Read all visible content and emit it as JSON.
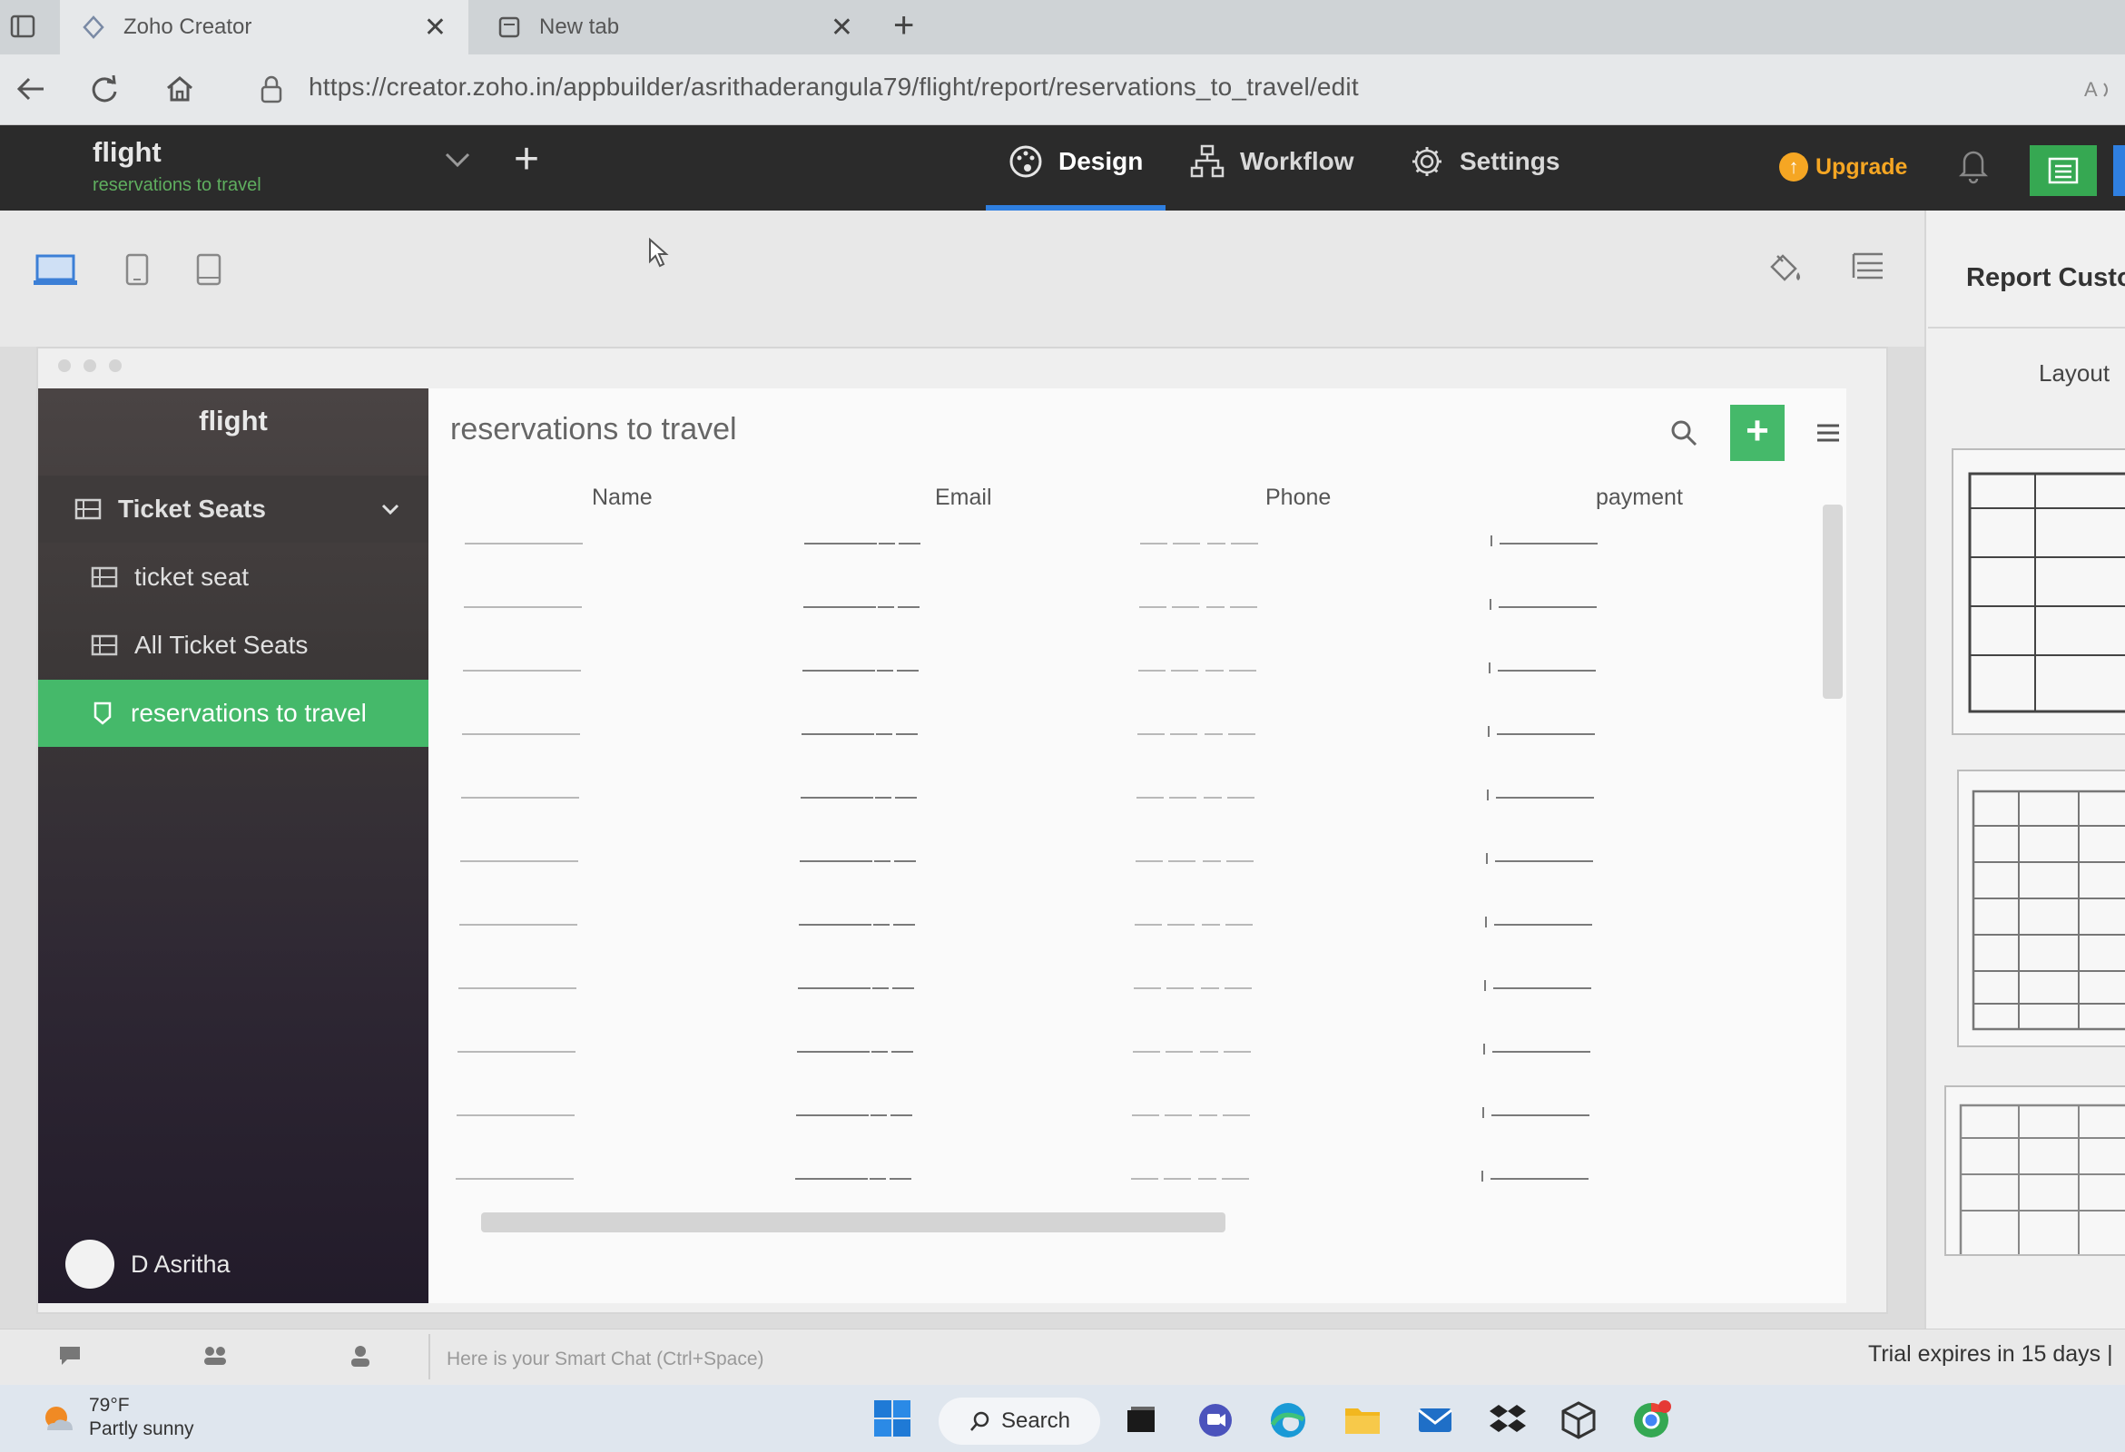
{
  "browser": {
    "tabs": [
      {
        "title": "Zoho Creator"
      },
      {
        "title": "New tab"
      }
    ],
    "close_glyph": "✕",
    "new_tab_glyph": "+",
    "url": "https://creator.zoho.in/appbuilder/asrithaderangula79/flight/report/reservations_to_travel/edit"
  },
  "app": {
    "name": "flight",
    "subtitle": "reservations to travel",
    "add_glyph": "+",
    "nav": {
      "design": "Design",
      "workflow": "Workflow",
      "settings": "Settings"
    },
    "upgrade": "Upgrade",
    "upgrade_glyph": "↑"
  },
  "sidebar": {
    "brand": "flight",
    "items": [
      {
        "label": "Ticket Seats",
        "level": 1,
        "icon": "table-icon"
      },
      {
        "label": "ticket seat",
        "level": 2,
        "icon": "table-icon"
      },
      {
        "label": "All Ticket Seats",
        "level": 2,
        "icon": "table-icon"
      },
      {
        "label": "reservations to travel",
        "level": 2,
        "icon": "report-icon",
        "active": true
      }
    ],
    "user": "D Asritha"
  },
  "report": {
    "title": "reservations to travel",
    "add_glyph": "+",
    "columns": [
      "Name",
      "Email",
      "Phone",
      "payment"
    ],
    "placeholder_rows": 11
  },
  "right_panel": {
    "title": "Report Customiz",
    "layout_label": "Layout"
  },
  "bottom": {
    "chat_placeholder": "Here is your Smart Chat (Ctrl+Space)",
    "trial": "Trial expires in 15 days",
    "trial_sep": "|"
  },
  "taskbar": {
    "temp": "79°F",
    "weather": "Partly sunny",
    "search": "Search"
  },
  "colors": {
    "accent_green": "#45b96a",
    "header_dark": "#2b2b2b",
    "design_underline": "#2f7fe0",
    "upgrade": "#f5a623"
  }
}
